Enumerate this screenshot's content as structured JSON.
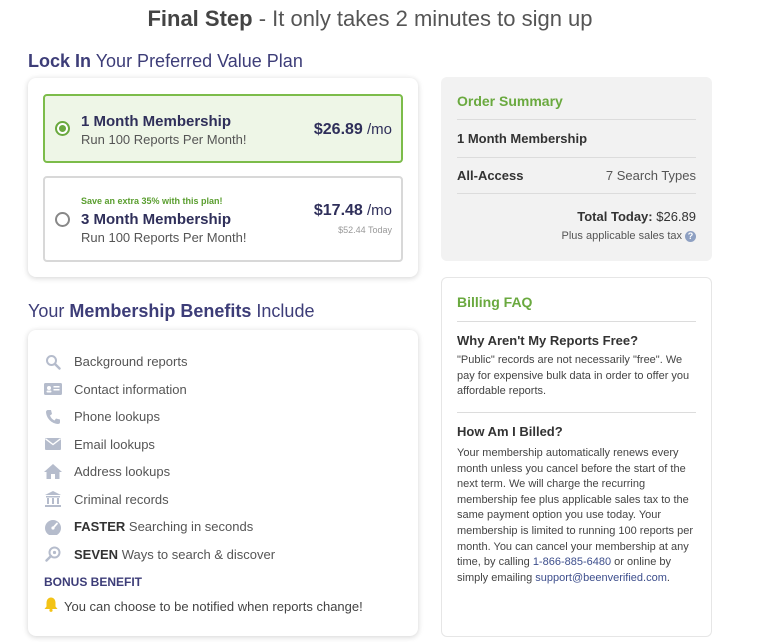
{
  "header": {
    "bold": "Final Step",
    "rest": " - It only takes 2 minutes to sign up"
  },
  "lock_section": {
    "bold": "Lock In",
    "rest": " Your Preferred Value Plan"
  },
  "plans": [
    {
      "name": "1 Month Membership",
      "sub": "Run 100 Reports Per Month!",
      "price": "$26.89",
      "unit": " /mo",
      "selected": true
    },
    {
      "promo": "Save an extra 35% with this plan!",
      "name": "3 Month Membership",
      "sub": "Run 100 Reports Per Month!",
      "price": "$17.48",
      "unit": " /mo",
      "note": "$52.44 Today",
      "selected": false
    }
  ],
  "benefits_section": {
    "pre": "Your ",
    "bold": "Membership Benefits",
    "post": " Include"
  },
  "benefits": [
    {
      "icon": "search-icon",
      "bold": "",
      "text": "Background reports"
    },
    {
      "icon": "contact-card-icon",
      "bold": "",
      "text": "Contact information"
    },
    {
      "icon": "phone-icon",
      "bold": "",
      "text": "Phone lookups"
    },
    {
      "icon": "envelope-icon",
      "bold": "",
      "text": "Email lookups"
    },
    {
      "icon": "house-icon",
      "bold": "",
      "text": "Address lookups"
    },
    {
      "icon": "courthouse-icon",
      "bold": "",
      "text": "Criminal records"
    },
    {
      "icon": "speedometer-icon",
      "bold": "FASTER",
      "text": " Searching in seconds"
    },
    {
      "icon": "magnifier-icon",
      "bold": "SEVEN",
      "text": " Ways to search & discover"
    }
  ],
  "bonus": {
    "label": "BONUS BENEFIT",
    "text": "You can choose to be notified when reports change!"
  },
  "order_summary": {
    "title": "Order Summary",
    "item": "1 Month Membership",
    "access_label": "All-Access",
    "access_value": "7 Search Types",
    "total_label": "Total Today:",
    "total_value": " $26.89",
    "tax_note": "Plus applicable sales tax"
  },
  "faq": {
    "title": "Billing FAQ",
    "q1": "Why Aren't My Reports Free?",
    "a1": "\"Public\" records are not necessarily \"free\". We pay for expensive bulk data in order to offer you affordable reports.",
    "q2": "How Am I Billed?",
    "a2_pre": "Your membership automatically renews every month unless you cancel before the start of the next term. We will charge the recurring membership fee plus applicable sales tax to the same payment option you use today. Your membership is limited to running 100 reports per month. You can cancel your membership at any time, by calling ",
    "a2_phone": "1-866-885-6480",
    "a2_mid": " or online by simply emailing ",
    "a2_email": "support@beenverified.com",
    "a2_end": "."
  },
  "colors": {
    "accent_green": "#6aa93f",
    "navy": "#3d3d78",
    "icon_grey": "#b5bccc"
  }
}
